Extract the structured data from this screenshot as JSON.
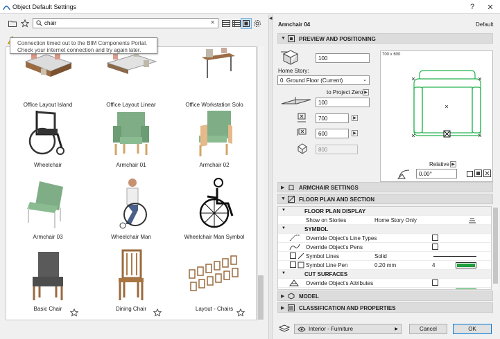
{
  "window": {
    "title": "Object Default Settings",
    "controls": {
      "help": "?",
      "close": "✕"
    }
  },
  "left": {
    "search": {
      "value": "chair",
      "placeholder": "Search"
    },
    "tooltip": {
      "line1": "Connection timed out to the BIM Components Portal.",
      "line2": "Check your internet connection and try again later."
    },
    "items": [
      {
        "label": "Office Layout Island",
        "icon": "office-island"
      },
      {
        "label": "Office Layout Linear",
        "icon": "office-linear"
      },
      {
        "label": "Office Workstation Solo",
        "icon": "office-solo"
      },
      {
        "label": "Wheelchair",
        "icon": "wheelchair"
      },
      {
        "label": "Armchair 01",
        "icon": "armchair"
      },
      {
        "label": "Armchair 02",
        "icon": "armchair-wood"
      },
      {
        "label": "Armchair 03",
        "icon": "armchair-green"
      },
      {
        "label": "Wheelchair Man",
        "icon": "wheelchair-man"
      },
      {
        "label": "Wheelchair Man Symbol",
        "icon": "wheelchair-symbol"
      },
      {
        "label": "Basic Chair",
        "icon": "basic-chair"
      },
      {
        "label": "Dining Chair",
        "icon": "dining-chair"
      },
      {
        "label": "Layout - Chairs",
        "icon": "chairs-layout"
      }
    ]
  },
  "right": {
    "object_name": "Armchair 04",
    "default_label": "Default",
    "sections": {
      "preview": "PREVIEW AND POSITIONING",
      "armchair": "ARMCHAIR SETTINGS",
      "floorplan": "FLOOR PLAN AND SECTION",
      "model": "MODEL",
      "classification": "CLASSIFICATION AND PROPERTIES"
    },
    "positioning": {
      "top_value": "100",
      "home_story_label": "Home Story:",
      "home_story_value": "0. Ground Floor (Current)",
      "to_project_zero": "to Project Zero",
      "elevation": "100",
      "width": "700",
      "depth": "600",
      "height": "800",
      "preview_size": "700 x 600",
      "relative": "Relative",
      "angle": "0.00°"
    },
    "properties": [
      {
        "type": "group",
        "name": "FLOOR PLAN DISPLAY"
      },
      {
        "type": "row",
        "name": "Show on Stories",
        "value": "Home Story Only"
      },
      {
        "type": "group",
        "name": "SYMBOL"
      },
      {
        "type": "row",
        "name": "Override Object's Line Types",
        "check": true
      },
      {
        "type": "row",
        "name": "Override Object's Pens",
        "check": true
      },
      {
        "type": "row",
        "name": "Symbol Lines",
        "value": "Solid"
      },
      {
        "type": "row",
        "name": "Symbol Line Pen",
        "value": "0.20 mm",
        "extra": "4"
      },
      {
        "type": "group",
        "name": "CUT SURFACES"
      },
      {
        "type": "row",
        "name": "Override Object's Attributes",
        "check": true
      }
    ],
    "layer": "Interior - Furniture",
    "buttons": {
      "cancel": "Cancel",
      "ok": "OK"
    },
    "colors": {
      "accent": "#0078d7",
      "plan_green": "#22b14c",
      "pen_green": "#1e9e3c"
    }
  }
}
